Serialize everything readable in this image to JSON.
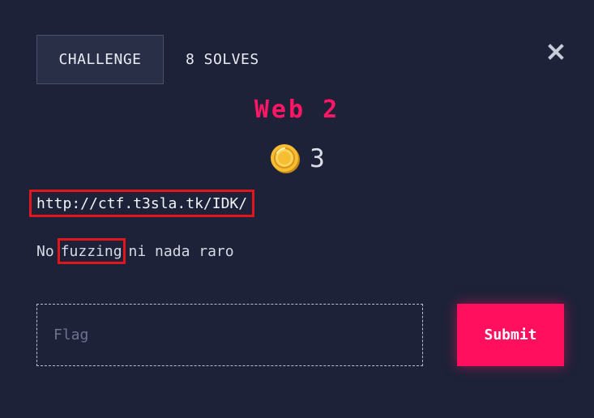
{
  "header": {
    "challenge_tab_label": "CHALLENGE",
    "solves_tab_label": "8 SOLVES",
    "close_icon": "close-icon"
  },
  "challenge": {
    "title": "Web 2",
    "points": "3",
    "points_icon": "coin-icon",
    "url": "http://ctf.t3sla.tk/IDK/",
    "description_prefix": "No",
    "description_highlight": "fuzzing",
    "description_suffix": "ni nada raro"
  },
  "form": {
    "flag_placeholder": "Flag",
    "flag_value": "",
    "submit_label": "Submit"
  },
  "colors": {
    "background": "#1d2238",
    "accent": "#ff1665",
    "highlight_border": "#e0161d",
    "coin": "#f5b82e"
  }
}
